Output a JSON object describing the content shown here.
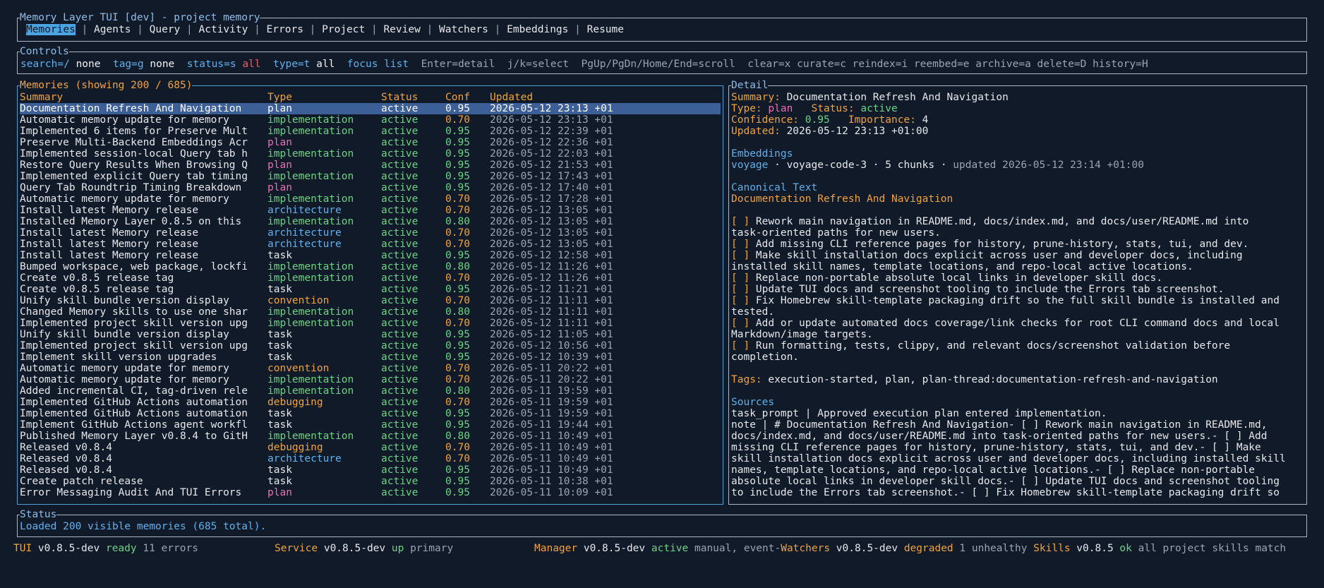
{
  "tabs_box": {
    "title": "Memory Layer TUI [dev] - project memory",
    "tabs": [
      "Memories",
      "Agents",
      "Query",
      "Activity",
      "Errors",
      "Project",
      "Review",
      "Watchers",
      "Embeddings",
      "Resume"
    ],
    "active_tab": "Memories"
  },
  "controls": {
    "title": "Controls",
    "search_key": "search=/",
    "search_val": "none",
    "tag_key": "tag=g",
    "tag_val": "none",
    "status_key": "status=s",
    "status_val": "all",
    "type_key": "type=t",
    "type_val": "all",
    "focus": "focus list",
    "hints": "Enter=detail  j/k=select  PgUp/PgDn/Home/End=scroll  clear=x curate=c reindex=i reembed=e archive=a delete=D history=H"
  },
  "memories": {
    "title": "Memories (showing 200 / 685)",
    "columns": [
      "Summary",
      "Type",
      "Status",
      "Conf",
      "Updated"
    ],
    "rows": [
      {
        "summary": "Documentation Refresh And Navigation",
        "type": "plan",
        "status": "active",
        "conf": "0.95",
        "updated": "2026-05-12 23:13 +01",
        "selected": true
      },
      {
        "summary": "Automatic memory update for memory",
        "type": "implementation",
        "status": "active",
        "conf": "0.70",
        "updated": "2026-05-12 23:13 +01"
      },
      {
        "summary": "Implemented 6 items for Preserve Mult",
        "type": "implementation",
        "status": "active",
        "conf": "0.95",
        "updated": "2026-05-12 22:39 +01"
      },
      {
        "summary": "Preserve Multi-Backend Embeddings Acr",
        "type": "plan",
        "status": "active",
        "conf": "0.95",
        "updated": "2026-05-12 22:36 +01"
      },
      {
        "summary": "Implemented session-local Query tab h",
        "type": "implementation",
        "status": "active",
        "conf": "0.95",
        "updated": "2026-05-12 22:03 +01"
      },
      {
        "summary": "Restore Query Results When Browsing Q",
        "type": "plan",
        "status": "active",
        "conf": "0.95",
        "updated": "2026-05-12 21:53 +01"
      },
      {
        "summary": "Implemented explicit Query tab timing",
        "type": "implementation",
        "status": "active",
        "conf": "0.95",
        "updated": "2026-05-12 17:43 +01"
      },
      {
        "summary": "Query Tab Roundtrip Timing Breakdown",
        "type": "plan",
        "status": "active",
        "conf": "0.95",
        "updated": "2026-05-12 17:40 +01"
      },
      {
        "summary": "Automatic memory update for memory",
        "type": "implementation",
        "status": "active",
        "conf": "0.70",
        "updated": "2026-05-12 17:28 +01"
      },
      {
        "summary": "Install latest Memory release",
        "type": "architecture",
        "status": "active",
        "conf": "0.70",
        "updated": "2026-05-12 13:05 +01"
      },
      {
        "summary": "Installed Memory Layer 0.8.5 on this",
        "type": "implementation",
        "status": "active",
        "conf": "0.80",
        "updated": "2026-05-12 13:05 +01"
      },
      {
        "summary": "Install latest Memory release",
        "type": "architecture",
        "status": "active",
        "conf": "0.70",
        "updated": "2026-05-12 13:05 +01"
      },
      {
        "summary": "Install latest Memory release",
        "type": "architecture",
        "status": "active",
        "conf": "0.70",
        "updated": "2026-05-12 13:05 +01"
      },
      {
        "summary": "Install latest Memory release",
        "type": "task",
        "status": "active",
        "conf": "0.95",
        "updated": "2026-05-12 12:58 +01"
      },
      {
        "summary": "Bumped workspace, web package, lockfi",
        "type": "implementation",
        "status": "active",
        "conf": "0.80",
        "updated": "2026-05-12 11:26 +01"
      },
      {
        "summary": "Create v0.8.5 release tag",
        "type": "implementation",
        "status": "active",
        "conf": "0.70",
        "updated": "2026-05-12 11:26 +01"
      },
      {
        "summary": "Create v0.8.5 release tag",
        "type": "task",
        "status": "active",
        "conf": "0.95",
        "updated": "2026-05-12 11:21 +01"
      },
      {
        "summary": "Unify skill bundle version display",
        "type": "convention",
        "status": "active",
        "conf": "0.70",
        "updated": "2026-05-12 11:11 +01"
      },
      {
        "summary": "Changed Memory skills to use one shar",
        "type": "implementation",
        "status": "active",
        "conf": "0.80",
        "updated": "2026-05-12 11:11 +01"
      },
      {
        "summary": "Implemented project skill version upg",
        "type": "implementation",
        "status": "active",
        "conf": "0.70",
        "updated": "2026-05-12 11:11 +01"
      },
      {
        "summary": "Unify skill bundle version display",
        "type": "task",
        "status": "active",
        "conf": "0.95",
        "updated": "2026-05-12 11:05 +01"
      },
      {
        "summary": "Implemented project skill version upg",
        "type": "task",
        "status": "active",
        "conf": "0.95",
        "updated": "2026-05-12 10:56 +01"
      },
      {
        "summary": "Implement skill version upgrades",
        "type": "task",
        "status": "active",
        "conf": "0.95",
        "updated": "2026-05-12 10:39 +01"
      },
      {
        "summary": "Automatic memory update for memory",
        "type": "convention",
        "status": "active",
        "conf": "0.70",
        "updated": "2026-05-11 20:22 +01"
      },
      {
        "summary": "Automatic memory update for memory",
        "type": "implementation",
        "status": "active",
        "conf": "0.70",
        "updated": "2026-05-11 20:22 +01"
      },
      {
        "summary": "Added incremental CI, tag-driven rele",
        "type": "implementation",
        "status": "active",
        "conf": "0.80",
        "updated": "2026-05-11 19:59 +01"
      },
      {
        "summary": "Implemented GitHub Actions automation",
        "type": "debugging",
        "status": "active",
        "conf": "0.70",
        "updated": "2026-05-11 19:59 +01"
      },
      {
        "summary": "Implemented GitHub Actions automation",
        "type": "task",
        "status": "active",
        "conf": "0.95",
        "updated": "2026-05-11 19:59 +01"
      },
      {
        "summary": "Implement GitHub Actions agent workfl",
        "type": "task",
        "status": "active",
        "conf": "0.95",
        "updated": "2026-05-11 19:44 +01"
      },
      {
        "summary": "Published Memory Layer v0.8.4 to GitH",
        "type": "implementation",
        "status": "active",
        "conf": "0.80",
        "updated": "2026-05-11 10:49 +01"
      },
      {
        "summary": "Released v0.8.4",
        "type": "debugging",
        "status": "active",
        "conf": "0.70",
        "updated": "2026-05-11 10:49 +01"
      },
      {
        "summary": "Released v0.8.4",
        "type": "architecture",
        "status": "active",
        "conf": "0.70",
        "updated": "2026-05-11 10:49 +01"
      },
      {
        "summary": "Released v0.8.4",
        "type": "task",
        "status": "active",
        "conf": "0.95",
        "updated": "2026-05-11 10:49 +01"
      },
      {
        "summary": "Create patch release",
        "type": "task",
        "status": "active",
        "conf": "0.95",
        "updated": "2026-05-11 10:38 +01"
      },
      {
        "summary": "Error Messaging Audit And TUI Errors",
        "type": "plan",
        "status": "active",
        "conf": "0.95",
        "updated": "2026-05-11 10:09 +01"
      }
    ]
  },
  "detail": {
    "title": "Detail",
    "summary_label": "Summary:",
    "summary_value": "Documentation Refresh And Navigation",
    "type_label": "Type:",
    "type_value": "plan",
    "status_label": "Status:",
    "status_value": "active",
    "confidence_label": "Confidence:",
    "confidence_value": "0.95",
    "importance_label": "Importance:",
    "importance_value": "4",
    "updated_label": "Updated:",
    "updated_value": "2026-05-12 23:13 +01:00",
    "embeddings_heading": "Embeddings",
    "embed_provider": "voyage",
    "embed_info": " · voyage-code-3 · 5 chunks · ",
    "embed_updated": "updated 2026-05-12 23:14 +01:00",
    "canonical_heading": "Canonical Text",
    "canonical_title": "Documentation Refresh And Navigation",
    "canonical_lines": [
      {
        "box": "[ ]",
        "text": " Rework main navigation in README.md, docs/index.md, and docs/user/README.md into"
      },
      {
        "box": "",
        "text": "task-oriented paths for new users."
      },
      {
        "box": "[ ]",
        "text": " Add missing CLI reference pages for history, prune-history, stats, tui, and dev."
      },
      {
        "box": "[ ]",
        "text": " Make skill installation docs explicit across user and developer docs, including"
      },
      {
        "box": "",
        "text": "installed skill names, template locations, and repo-local active locations."
      },
      {
        "box": "[ ]",
        "text": " Replace non-portable absolute local links in developer skill docs."
      },
      {
        "box": "[ ]",
        "text": " Update TUI docs and screenshot tooling to include the Errors tab screenshot."
      },
      {
        "box": "[ ]",
        "text": " Fix Homebrew skill-template packaging drift so the full skill bundle is installed and"
      },
      {
        "box": "",
        "text": "tested."
      },
      {
        "box": "[ ]",
        "text": " Add or update automated docs coverage/link checks for root CLI command docs and local"
      },
      {
        "box": "",
        "text": "Markdown/image targets."
      },
      {
        "box": "[ ]",
        "text": " Run formatting, tests, clippy, and relevant docs/screenshot validation before"
      },
      {
        "box": "",
        "text": "completion."
      }
    ],
    "tags_label": "Tags:",
    "tags_value": "execution-started, plan, plan-thread:documentation-refresh-and-navigation",
    "sources_heading": "Sources",
    "source_lines": [
      "task_prompt | Approved execution plan entered implementation.",
      "note | # Documentation Refresh And Navigation- [ ] Rework main navigation in README.md,",
      "docs/index.md, and docs/user/README.md into task-oriented paths for new users.- [ ] Add",
      "missing CLI reference pages for history, prune-history, stats, tui, and dev.- [ ] Make",
      "skill installation docs explicit across user and developer docs, including installed skill",
      "names, template locations, and repo-local active locations.- [ ] Replace non-portable",
      "absolute local links in developer skill docs.- [ ] Update TUI docs and screenshot tooling",
      "to include the Errors tab screenshot.- [ ] Fix Homebrew skill-template packaging drift so"
    ]
  },
  "status": {
    "title": "Status",
    "message": "Loaded 200 visible memories (685 total)."
  },
  "statusbar": {
    "tui_label": "TUI",
    "tui_version": " v0.8.5-dev ",
    "tui_state": "ready",
    "tui_extra": " 11 errors",
    "service_label": "Service",
    "service_version": " v0.8.5-dev ",
    "service_state": "up",
    "service_extra": " primary",
    "manager_label": "Manager",
    "manager_version": " v0.8.5-dev ",
    "manager_state": "active",
    "manager_extra": " manual, event-",
    "watchers_label": "Watchers",
    "watchers_version": " v0.8.5-dev ",
    "watchers_state": "degraded",
    "watchers_extra": " 1 unhealthy ",
    "skills_label": "Skills",
    "skills_version": " v0.8.5 ",
    "skills_state": "ok",
    "skills_extra": " all project skills match"
  },
  "type_colors": {
    "plan": "#ea70b8",
    "implementation": "#6dd384",
    "architecture": "#5fb0ee",
    "task": "#e6e8ec",
    "convention": "#f0a33e",
    "debugging": "#f0a33e"
  },
  "conf_colors": {
    "0.95": "#6dd384",
    "0.80": "#6dd384",
    "0.70": "#f0a33e"
  }
}
